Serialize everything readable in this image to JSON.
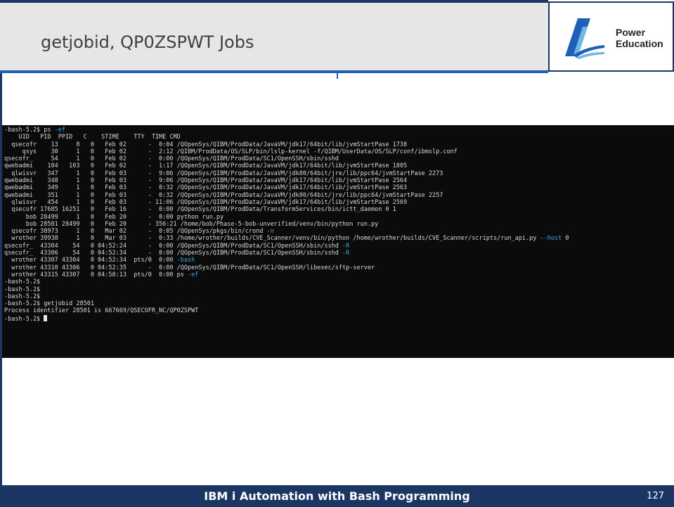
{
  "slide": {
    "title": "getjobid, QP0ZSPWT Jobs",
    "page_number": "127",
    "footer": "IBM i Automation with Bash Programming"
  },
  "logo": {
    "line1": "Power",
    "line2": "Education"
  },
  "colors": {
    "navy": "#1c3664",
    "accent_blue": "#1f5fb8",
    "terminal_bg": "#0b0b0b",
    "terminal_text": "#d8d8d8",
    "flag_blue": "#36a9e8"
  },
  "terminal": {
    "lines": [
      {
        "text": "-bash-5.2$ ps ",
        "flag": "-ef",
        "after": ""
      },
      {
        "text": "    UID   PID  PPID   C    STIME    TTY  TIME CMD",
        "flag": "",
        "after": ""
      },
      {
        "text": "  qsecofr    13     8   0   Feb 02      -  0:04 /QOpenSys/QIBM/ProdData/JavaVM/jdk17/64bit/lib/jvmStartPase 1738",
        "flag": "",
        "after": ""
      },
      {
        "text": "     qsys    30     1   0   Feb 02      -  2:12 /QIBM/ProdData/OS/SLP/bin/lslp-kernel -f/QIBM/UserData/OS/SLP/conf/ibmslp.conf",
        "flag": "",
        "after": ""
      },
      {
        "text": "qsecofr_     54     1   0   Feb 02      -  0:00 /QOpenSys/QIBM/ProdData/SC1/OpenSSH/sbin/sshd",
        "flag": "",
        "after": ""
      },
      {
        "text": "qwebadmi    104   103   0   Feb 02      -  1:17 /QOpenSys/QIBM/ProdData/JavaVM/jdk17/64bit/lib/jvmStartPase 1805",
        "flag": "",
        "after": ""
      },
      {
        "text": "  qlwisvr   347     1   0   Feb 03      -  9:06 /QOpenSys/QIBM/ProdData/JavaVM/jdk80/64bit/jre/lib/ppc64/jvmStartPase 2273",
        "flag": "",
        "after": ""
      },
      {
        "text": "qwebadmi    348     1   0   Feb 03      -  9:06 /QOpenSys/QIBM/ProdData/JavaVM/jdk17/64bit/lib/jvmStartPase 2564",
        "flag": "",
        "after": ""
      },
      {
        "text": "qwebadmi    349     1   0   Feb 03      -  0:32 /QOpenSys/QIBM/ProdData/JavaVM/jdk17/64bit/lib/jvmStartPase 2563",
        "flag": "",
        "after": ""
      },
      {
        "text": "qwebadmi    351     1   0   Feb 03      -  0:32 /QOpenSys/QIBM/ProdData/JavaVM/jdk80/64bit/jre/lib/ppc64/jvmStartPase 2257",
        "flag": "",
        "after": ""
      },
      {
        "text": "  qlwisvr   454     1   0   Feb 03      - 11:06 /QOpenSys/QIBM/ProdData/JavaVM/jdk17/64bit/lib/jvmStartPase 2569",
        "flag": "",
        "after": ""
      },
      {
        "text": "  qsecofr 17685 16251   0   Feb 16      -  0:00 /QOpenSys/QIBM/ProdData/TransformServices/bin/ictt_daemon 0 1",
        "flag": "",
        "after": ""
      },
      {
        "text": "      bob 28499     1   0   Feb 20      -  0:00 python run.py",
        "flag": "",
        "after": ""
      },
      {
        "text": "      bob 28501 28499   0   Feb 20      - 356:21 /home/bob/Phase-5-bob-unverified/venv/bin/python run.py",
        "flag": "",
        "after": ""
      },
      {
        "text": "  qsecofr 38973     1   0   Mar 02      -  0:05 /QOpenSys/pkgs/bin/crond ",
        "flag": "-n",
        "after": ""
      },
      {
        "text": "  wrother 39938     1   0   Mar 03      -  0:33 /home/wrother/builds/CVE_Scanner/venv/bin/python /home/wrother/builds/CVE_Scanner/scripts/run_api.py ",
        "flag": "--host",
        "after": " 0"
      },
      {
        "text": "qsecofr_  43304    54   0 04:52:24      -  0:00 /QOpenSys/QIBM/ProdData/SC1/OpenSSH/sbin/sshd ",
        "flag": "-R",
        "after": ""
      },
      {
        "text": "qsecofr_  43306    54   0 04:52:34      -  0:00 /QOpenSys/QIBM/ProdData/SC1/OpenSSH/sbin/sshd ",
        "flag": "-R",
        "after": ""
      },
      {
        "text": "  wrother 43307 43304   0 04:52:34  pts/0  0:00 ",
        "flag": "-bash",
        "after": ""
      },
      {
        "text": "  wrother 43310 43306   0 04:52:35      -  0:00 /QOpenSys/QIBM/ProdData/SC1/OpenSSH/libexec/sftp-server",
        "flag": "",
        "after": ""
      },
      {
        "text": "  wrother 43315 43307   0 04:58:13  pts/0  0:00 ps ",
        "flag": "-ef",
        "after": ""
      },
      {
        "text": "-bash-5.2$",
        "flag": "",
        "after": ""
      },
      {
        "text": "-bash-5.2$",
        "flag": "",
        "after": ""
      },
      {
        "text": "-bash-5.2$",
        "flag": "",
        "after": ""
      },
      {
        "text": "-bash-5.2$ getjobid 28501",
        "flag": "",
        "after": ""
      },
      {
        "text": "Process identifier 28501 is 667669/QSECOFR_NC/QP0ZSPWT",
        "flag": "",
        "after": ""
      },
      {
        "text": "-bash-5.2$ ",
        "flag": "",
        "after": ""
      }
    ]
  }
}
